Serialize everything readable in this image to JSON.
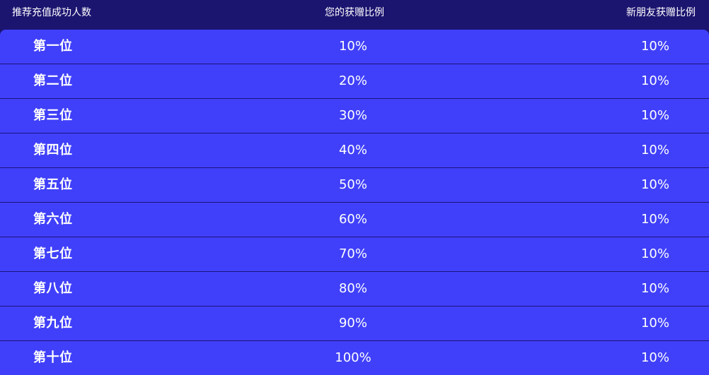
{
  "header": {
    "col1": "推荐充值成功人数",
    "col2": "您的获赠比例",
    "col3": "新朋友获赠比例"
  },
  "rows": [
    {
      "rank": "第一位",
      "yours": "10%",
      "friend": "10%"
    },
    {
      "rank": "第二位",
      "yours": "20%",
      "friend": "10%"
    },
    {
      "rank": "第三位",
      "yours": "30%",
      "friend": "10%"
    },
    {
      "rank": "第四位",
      "yours": "40%",
      "friend": "10%"
    },
    {
      "rank": "第五位",
      "yours": "50%",
      "friend": "10%"
    },
    {
      "rank": "第六位",
      "yours": "60%",
      "friend": "10%"
    },
    {
      "rank": "第七位",
      "yours": "70%",
      "friend": "10%"
    },
    {
      "rank": "第八位",
      "yours": "80%",
      "friend": "10%"
    },
    {
      "rank": "第九位",
      "yours": "90%",
      "friend": "10%"
    },
    {
      "rank": "第十位",
      "yours": "100%",
      "friend": "10%"
    }
  ],
  "colors": {
    "background": "#1c1570",
    "table": "#4040fa",
    "divider": "#1b147a",
    "text": "#ffffff"
  }
}
